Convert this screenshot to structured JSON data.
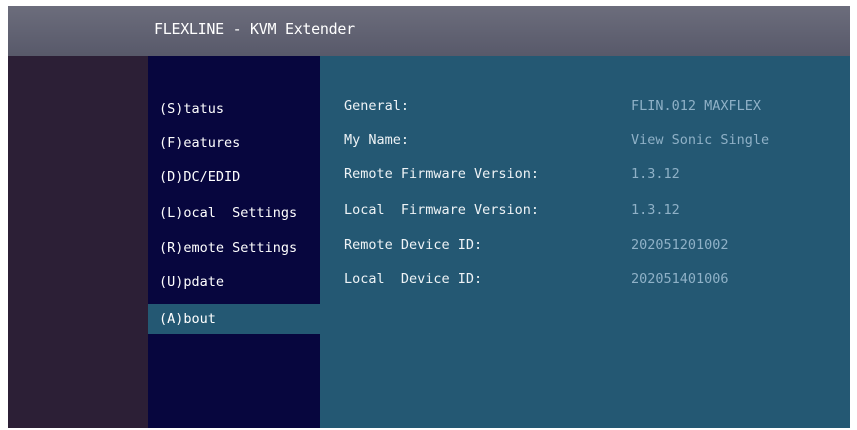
{
  "window": {
    "title": "FLEXLINE - KVM Extender"
  },
  "nav": {
    "items": [
      {
        "label": "(S)tatus"
      },
      {
        "label": "(F)eatures"
      },
      {
        "label": "(D)DC/EDID"
      },
      {
        "label": "(L)ocal  Settings"
      },
      {
        "label": "(R)emote Settings"
      },
      {
        "label": "(U)pdate"
      },
      {
        "label": "(A)bout"
      }
    ],
    "selected": "(A)bout"
  },
  "about": {
    "rows": [
      {
        "label": "General:",
        "value": "FLIN.012 MAXFLEX"
      },
      {
        "label": "My Name:",
        "value": "View Sonic Single"
      },
      {
        "label": "Remote Firmware Version:",
        "value": "1.3.12"
      },
      {
        "label": "Local  Firmware Version:",
        "value": "1.3.12"
      },
      {
        "label": "Remote Device ID:",
        "value": "202051201002"
      },
      {
        "label": "Local  Device ID:",
        "value": "202051401006"
      }
    ]
  },
  "colors": {
    "titlebar": "#626373",
    "nav_background": "#07063e",
    "content_background": "#245873",
    "outer_background": "#2c1f36",
    "value_text": "#8fb1c7"
  }
}
